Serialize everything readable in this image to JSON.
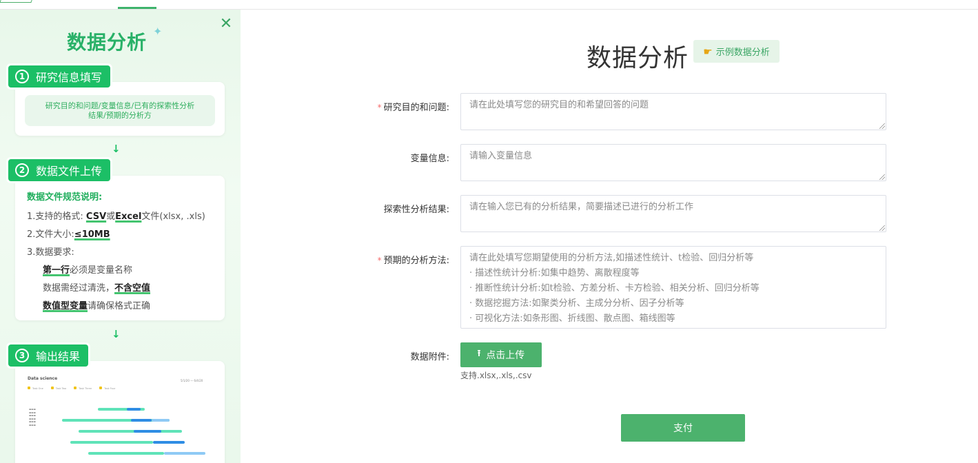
{
  "sidebar": {
    "title": "数据分析",
    "step1": {
      "num": "1",
      "label": "研究信息填写",
      "desc_line1": "研究目的和问题/变量信息/已有的探索性分析",
      "desc_line2": "结果/预期的分析方"
    },
    "step2": {
      "num": "2",
      "label": "数据文件上传",
      "spec_title": "数据文件规范说明:",
      "rule1_prefix": "1.支持的格式: ",
      "rule1_csv": "CSV",
      "rule1_or": "或",
      "rule1_excel": "Excel",
      "rule1_suffix": "文件(xlsx, .xls)",
      "rule2_prefix": "2.文件大小:",
      "rule2_value": "≤10MB",
      "rule3": "3.数据要求:",
      "req1_bold": "第一行",
      "req1_rest": "必须是变量名称",
      "req2_prefix": "数据需经过清洗，",
      "req2_bold": "不含空值",
      "req3_bold": "数值型变量",
      "req3_rest": "请确保格式正确"
    },
    "step3": {
      "num": "3",
      "label": "输出结果",
      "preview_title": "Data science",
      "preview_date": "5/1/20 — 6/4/20",
      "preview_legend": [
        "Task One",
        "Task Two",
        "Task Three",
        "Task Four"
      ]
    }
  },
  "main": {
    "title": "数据分析",
    "example_button": "示例数据分析",
    "fields": [
      {
        "label": "研究目的和问题:",
        "required": "*",
        "placeholder": "请在此处填写您的研究目的和希望回答的问题"
      },
      {
        "label": "变量信息:",
        "required": "",
        "placeholder": "请输入变量信息"
      },
      {
        "label": "探索性分析结果:",
        "required": "",
        "placeholder": "请在输入您已有的分析结果，简要描述已进行的分析工作"
      },
      {
        "label": "预期的分析方法:",
        "required": "*",
        "placeholder_lines": [
          "请在此处填写您期望使用的分析方法,如描述性统计、t检验、回归分析等",
          "· 描述性统计分析:如集中趋势、离散程度等",
          "· 推断性统计分析:如t检验、方差分析、卡方检验、相关分析、回归分析等",
          "· 数据挖掘方法:如聚类分析、主成分分析、因子分析等",
          "· 可视化方法:如条形图、折线图、散点图、箱线图等"
        ]
      }
    ],
    "attachment_label": "数据附件:",
    "upload_button": "点击上传",
    "upload_hint": "支持.xlsx,.xls,.csv",
    "pay_button": "支付"
  },
  "colors": {
    "brand": "#1cbf66",
    "button": "#4cb26d",
    "required": "#f56c6c"
  },
  "icons": {
    "close": "close-icon",
    "sparkle": "sparkle-icon",
    "hand": "pointing-hand-icon",
    "upload": "upload-icon",
    "arrow": "arrow-down-icon"
  }
}
